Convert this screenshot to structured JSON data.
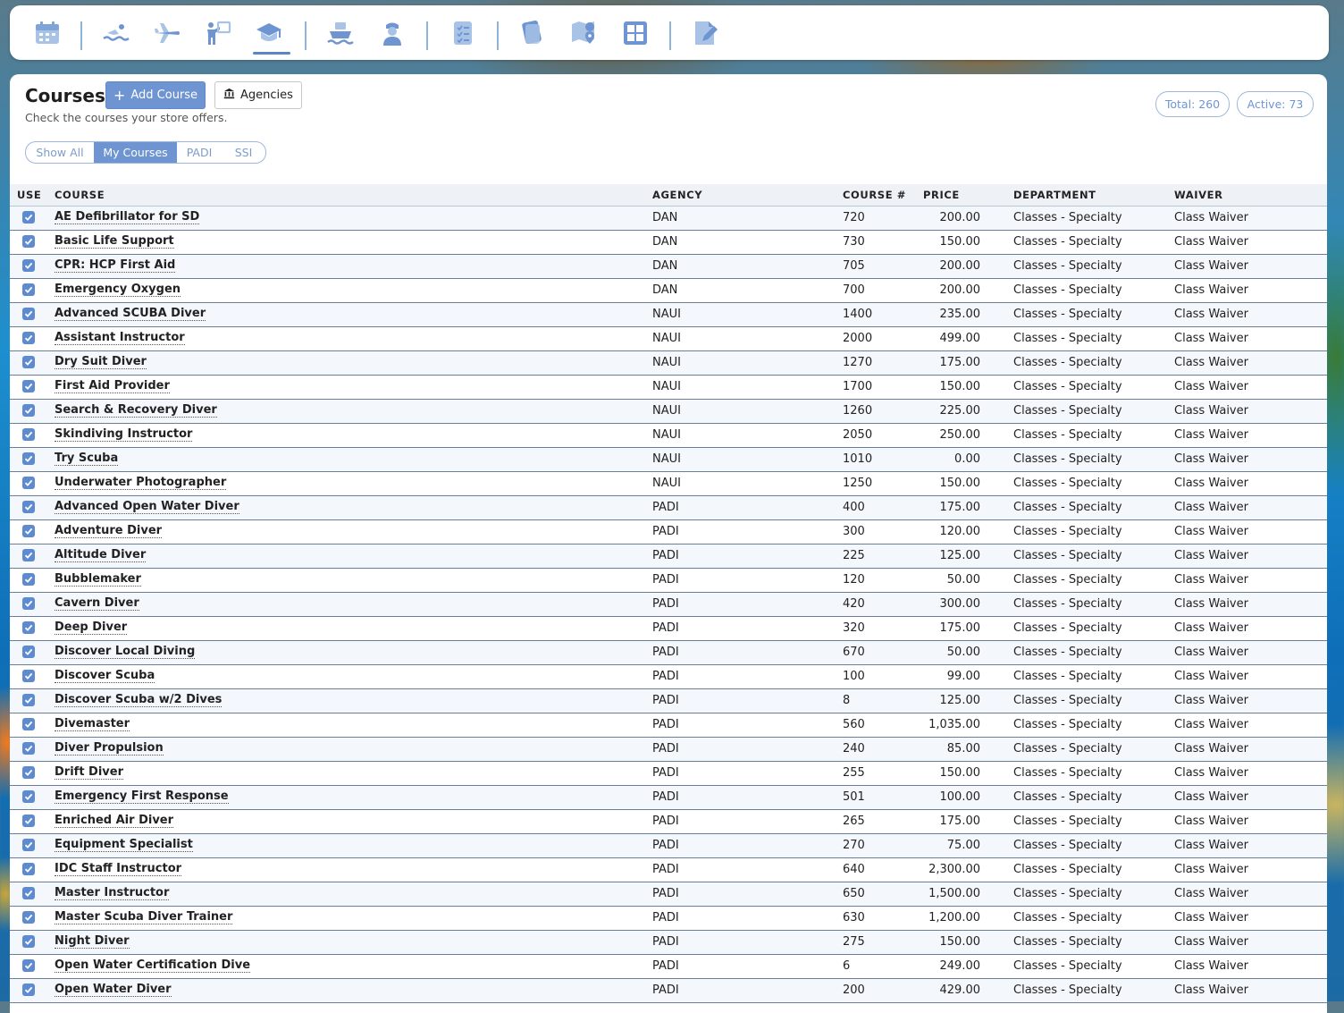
{
  "toolbar": {
    "icons": [
      "calendar-icon",
      "swimmer-icon",
      "airplane-icon",
      "instructor-icon",
      "graduation-cap-icon",
      "boat-icon",
      "captain-icon",
      "checklist-icon",
      "cards-icon",
      "map-pin-icon",
      "grid-icon",
      "document-edit-icon"
    ],
    "active": "graduation-cap-icon"
  },
  "header": {
    "title": "Courses",
    "add_button": "Add Course",
    "agencies_button": "Agencies",
    "subtitle": "Check the courses your store offers.",
    "total": "Total: 260",
    "active": "Active: 73"
  },
  "filters": [
    "Show All",
    "My Courses",
    "PADI",
    "SSI"
  ],
  "filter_selected": "My Courses",
  "columns": {
    "use": "USE",
    "course": "COURSE",
    "agency": "AGENCY",
    "number": "COURSE #",
    "price": "PRICE",
    "department": "DEPARTMENT",
    "waiver": "WAIVER"
  },
  "colors": {
    "accent": "#6e95d2",
    "row_divider": "#6a7f96"
  },
  "courses": [
    {
      "name": "AE Defibrillator for SD",
      "agency": "DAN",
      "number": "720",
      "price": "200.00",
      "department": "Classes - Specialty",
      "waiver": "Class Waiver",
      "use": true
    },
    {
      "name": "Basic Life Support",
      "agency": "DAN",
      "number": "730",
      "price": "150.00",
      "department": "Classes - Specialty",
      "waiver": "Class Waiver",
      "use": true
    },
    {
      "name": "CPR: HCP First Aid",
      "agency": "DAN",
      "number": "705",
      "price": "200.00",
      "department": "Classes - Specialty",
      "waiver": "Class Waiver",
      "use": true
    },
    {
      "name": "Emergency Oxygen",
      "agency": "DAN",
      "number": "700",
      "price": "200.00",
      "department": "Classes - Specialty",
      "waiver": "Class Waiver",
      "use": true
    },
    {
      "name": "Advanced SCUBA Diver",
      "agency": "NAUI",
      "number": "1400",
      "price": "235.00",
      "department": "Classes - Specialty",
      "waiver": "Class Waiver",
      "use": true
    },
    {
      "name": "Assistant Instructor",
      "agency": "NAUI",
      "number": "2000",
      "price": "499.00",
      "department": "Classes - Specialty",
      "waiver": "Class Waiver",
      "use": true
    },
    {
      "name": "Dry Suit Diver",
      "agency": "NAUI",
      "number": "1270",
      "price": "175.00",
      "department": "Classes - Specialty",
      "waiver": "Class Waiver",
      "use": true
    },
    {
      "name": "First Aid Provider",
      "agency": "NAUI",
      "number": "1700",
      "price": "150.00",
      "department": "Classes - Specialty",
      "waiver": "Class Waiver",
      "use": true
    },
    {
      "name": "Search & Recovery Diver",
      "agency": "NAUI",
      "number": "1260",
      "price": "225.00",
      "department": "Classes - Specialty",
      "waiver": "Class Waiver",
      "use": true
    },
    {
      "name": "Skindiving Instructor",
      "agency": "NAUI",
      "number": "2050",
      "price": "250.00",
      "department": "Classes - Specialty",
      "waiver": "Class Waiver",
      "use": true
    },
    {
      "name": "Try Scuba",
      "agency": "NAUI",
      "number": "1010",
      "price": "0.00",
      "department": "Classes - Specialty",
      "waiver": "Class Waiver",
      "use": true
    },
    {
      "name": "Underwater Photographer",
      "agency": "NAUI",
      "number": "1250",
      "price": "150.00",
      "department": "Classes - Specialty",
      "waiver": "Class Waiver",
      "use": true
    },
    {
      "name": "Advanced Open Water Diver",
      "agency": "PADI",
      "number": "400",
      "price": "175.00",
      "department": "Classes - Specialty",
      "waiver": "Class Waiver",
      "use": true
    },
    {
      "name": "Adventure Diver",
      "agency": "PADI",
      "number": "300",
      "price": "120.00",
      "department": "Classes - Specialty",
      "waiver": "Class Waiver",
      "use": true
    },
    {
      "name": "Altitude Diver",
      "agency": "PADI",
      "number": "225",
      "price": "125.00",
      "department": "Classes - Specialty",
      "waiver": "Class Waiver",
      "use": true
    },
    {
      "name": "Bubblemaker",
      "agency": "PADI",
      "number": "120",
      "price": "50.00",
      "department": "Classes - Specialty",
      "waiver": "Class Waiver",
      "use": true
    },
    {
      "name": "Cavern Diver",
      "agency": "PADI",
      "number": "420",
      "price": "300.00",
      "department": "Classes - Specialty",
      "waiver": "Class Waiver",
      "use": true
    },
    {
      "name": "Deep Diver",
      "agency": "PADI",
      "number": "320",
      "price": "175.00",
      "department": "Classes - Specialty",
      "waiver": "Class Waiver",
      "use": true
    },
    {
      "name": "Discover Local Diving",
      "agency": "PADI",
      "number": "670",
      "price": "50.00",
      "department": "Classes - Specialty",
      "waiver": "Class Waiver",
      "use": true
    },
    {
      "name": "Discover Scuba",
      "agency": "PADI",
      "number": "100",
      "price": "99.00",
      "department": "Classes - Specialty",
      "waiver": "Class Waiver",
      "use": true
    },
    {
      "name": "Discover Scuba w/2 Dives",
      "agency": "PADI",
      "number": "8",
      "price": "125.00",
      "department": "Classes - Specialty",
      "waiver": "Class Waiver",
      "use": true
    },
    {
      "name": "Divemaster",
      "agency": "PADI",
      "number": "560",
      "price": "1,035.00",
      "department": "Classes - Specialty",
      "waiver": "Class Waiver",
      "use": true
    },
    {
      "name": "Diver Propulsion",
      "agency": "PADI",
      "number": "240",
      "price": "85.00",
      "department": "Classes - Specialty",
      "waiver": "Class Waiver",
      "use": true
    },
    {
      "name": "Drift Diver",
      "agency": "PADI",
      "number": "255",
      "price": "150.00",
      "department": "Classes - Specialty",
      "waiver": "Class Waiver",
      "use": true
    },
    {
      "name": "Emergency First Response",
      "agency": "PADI",
      "number": "501",
      "price": "100.00",
      "department": "Classes - Specialty",
      "waiver": "Class Waiver",
      "use": true
    },
    {
      "name": "Enriched Air Diver",
      "agency": "PADI",
      "number": "265",
      "price": "175.00",
      "department": "Classes - Specialty",
      "waiver": "Class Waiver",
      "use": true
    },
    {
      "name": "Equipment Specialist",
      "agency": "PADI",
      "number": "270",
      "price": "75.00",
      "department": "Classes - Specialty",
      "waiver": "Class Waiver",
      "use": true
    },
    {
      "name": "IDC Staff Instructor",
      "agency": "PADI",
      "number": "640",
      "price": "2,300.00",
      "department": "Classes - Specialty",
      "waiver": "Class Waiver",
      "use": true
    },
    {
      "name": "Master Instructor",
      "agency": "PADI",
      "number": "650",
      "price": "1,500.00",
      "department": "Classes - Specialty",
      "waiver": "Class Waiver",
      "use": true
    },
    {
      "name": "Master Scuba Diver Trainer",
      "agency": "PADI",
      "number": "630",
      "price": "1,200.00",
      "department": "Classes - Specialty",
      "waiver": "Class Waiver",
      "use": true
    },
    {
      "name": "Night Diver",
      "agency": "PADI",
      "number": "275",
      "price": "150.00",
      "department": "Classes - Specialty",
      "waiver": "Class Waiver",
      "use": true
    },
    {
      "name": "Open Water Certification Dive",
      "agency": "PADI",
      "number": "6",
      "price": "249.00",
      "department": "Classes - Specialty",
      "waiver": "Class Waiver",
      "use": true
    },
    {
      "name": "Open Water Diver",
      "agency": "PADI",
      "number": "200",
      "price": "429.00",
      "department": "Classes - Specialty",
      "waiver": "Class Waiver",
      "use": true
    }
  ]
}
